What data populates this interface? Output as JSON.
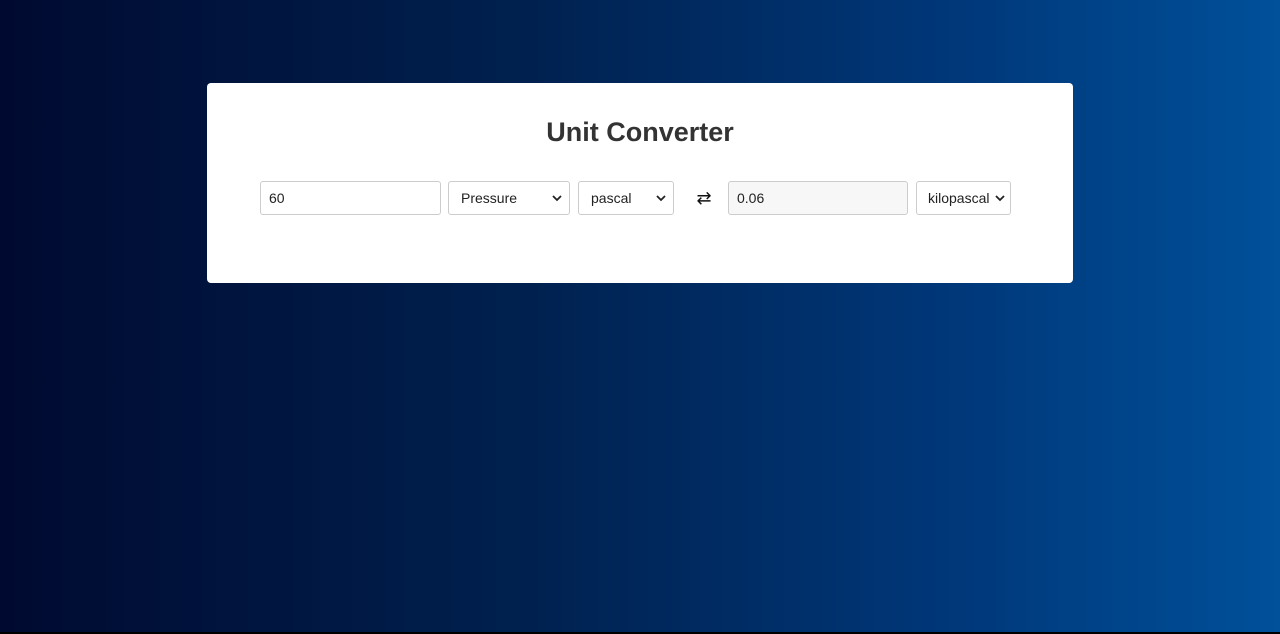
{
  "app": {
    "title": "Unit Converter"
  },
  "converter": {
    "input_value": "60",
    "category": "Pressure",
    "from_unit": "pascal",
    "swap_icon": "swap-arrows-icon",
    "swap_glyph": "⇄",
    "output_value": "0.06",
    "to_unit": "kilopascal"
  },
  "colors": {
    "card_background": "#ffffff",
    "title_color": "#333333",
    "gradient_start": "#000a30",
    "gradient_end": "#00509a"
  }
}
